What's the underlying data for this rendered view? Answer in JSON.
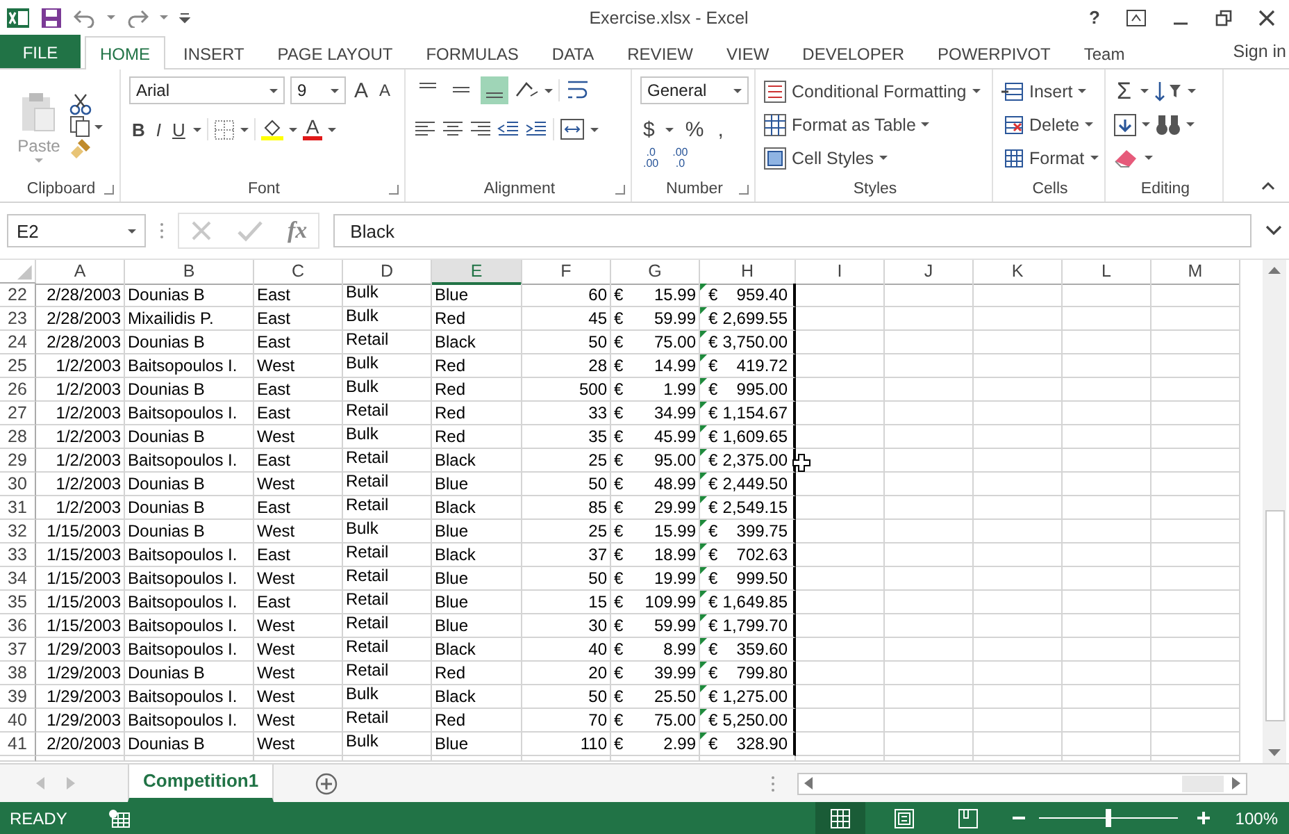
{
  "title_bar": {
    "title": "Exercise.xlsx - Excel",
    "help": "?"
  },
  "tabs": [
    {
      "label": "FILE",
      "kind": "file",
      "selected": false
    },
    {
      "label": "HOME",
      "kind": "tab",
      "selected": true
    },
    {
      "label": "INSERT",
      "kind": "tab",
      "selected": false
    },
    {
      "label": "PAGE LAYOUT",
      "kind": "tab",
      "selected": false
    },
    {
      "label": "FORMULAS",
      "kind": "tab",
      "selected": false
    },
    {
      "label": "DATA",
      "kind": "tab",
      "selected": false
    },
    {
      "label": "REVIEW",
      "kind": "tab",
      "selected": false
    },
    {
      "label": "VIEW",
      "kind": "tab",
      "selected": false
    },
    {
      "label": "DEVELOPER",
      "kind": "tab",
      "selected": false
    },
    {
      "label": "POWERPIVOT",
      "kind": "tab",
      "selected": false
    },
    {
      "label": "Team",
      "kind": "tab",
      "selected": false
    }
  ],
  "sign_in": "Sign in",
  "ribbon": {
    "clipboard": {
      "label": "Clipboard",
      "paste": "Paste"
    },
    "font": {
      "label": "Font",
      "name": "Arial",
      "size": "9",
      "grow": "A",
      "shrink": "A",
      "styles": [
        "B",
        "I",
        "U"
      ],
      "color_letter": "A"
    },
    "alignment": {
      "label": "Alignment",
      "vertical": [
        {
          "kind": "top",
          "selected": false
        },
        {
          "kind": "middle",
          "selected": false
        },
        {
          "kind": "bottom",
          "selected": true
        }
      ]
    },
    "number": {
      "label": "Number",
      "format": "General",
      "currency": "$",
      "percent": "%",
      "comma": ",",
      "increase_decimal": [
        ".0",
        ".00"
      ],
      "decrease_decimal": [
        ".00",
        ".0"
      ]
    },
    "styles": {
      "label": "Styles",
      "items": [
        {
          "kind": "conditional",
          "label": "Conditional Formatting"
        },
        {
          "kind": "table",
          "label": "Format as Table"
        },
        {
          "kind": "cell",
          "label": "Cell Styles"
        }
      ]
    },
    "cells": {
      "label": "Cells",
      "items": [
        {
          "kind": "insert",
          "label": "Insert"
        },
        {
          "kind": "delete",
          "label": "Delete"
        },
        {
          "kind": "format",
          "label": "Format"
        }
      ]
    },
    "editing": {
      "label": "Editing",
      "sum": "Σ"
    }
  },
  "formula_bar": {
    "name_box": "E2",
    "fx": "fx",
    "value": "Black"
  },
  "sheet": {
    "columns": [
      {
        "label": "A",
        "selected": false
      },
      {
        "label": "B",
        "selected": false
      },
      {
        "label": "C",
        "selected": false
      },
      {
        "label": "D",
        "selected": false
      },
      {
        "label": "E",
        "selected": true
      },
      {
        "label": "F",
        "selected": false
      },
      {
        "label": "G",
        "selected": false
      },
      {
        "label": "H",
        "selected": false
      },
      {
        "label": "I",
        "selected": false
      },
      {
        "label": "J",
        "selected": false
      },
      {
        "label": "K",
        "selected": false
      },
      {
        "label": "L",
        "selected": false
      },
      {
        "label": "M",
        "selected": false
      }
    ],
    "rows": [
      {
        "n": "22",
        "a": "2/28/2003",
        "b": "Dounias B",
        "c": "East",
        "d": "Bulk",
        "e": "Blue",
        "f": "60",
        "g": [
          "€",
          "15.99"
        ],
        "h": [
          "€",
          "959.40"
        ],
        "flag": true
      },
      {
        "n": "23",
        "a": "2/28/2003",
        "b": "Mixailidis P.",
        "c": "East",
        "d": "Bulk",
        "e": "Red",
        "f": "45",
        "g": [
          "€",
          "59.99"
        ],
        "h": [
          "€",
          "2,699.55"
        ],
        "flag": true
      },
      {
        "n": "24",
        "a": "2/28/2003",
        "b": "Dounias B",
        "c": "East",
        "d": "Retail",
        "e": "Black",
        "f": "50",
        "g": [
          "€",
          "75.00"
        ],
        "h": [
          "€",
          "3,750.00"
        ],
        "flag": true
      },
      {
        "n": "25",
        "a": "1/2/2003",
        "b": "Baitsopoulos I.",
        "c": "West",
        "d": "Bulk",
        "e": "Red",
        "f": "28",
        "g": [
          "€",
          "14.99"
        ],
        "h": [
          "€",
          "419.72"
        ],
        "flag": true
      },
      {
        "n": "26",
        "a": "1/2/2003",
        "b": "Dounias B",
        "c": "East",
        "d": "Bulk",
        "e": "Red",
        "f": "500",
        "g": [
          "€",
          "1.99"
        ],
        "h": [
          "€",
          "995.00"
        ],
        "flag": true
      },
      {
        "n": "27",
        "a": "1/2/2003",
        "b": "Baitsopoulos I.",
        "c": "East",
        "d": "Retail",
        "e": "Red",
        "f": "33",
        "g": [
          "€",
          "34.99"
        ],
        "h": [
          "€",
          "1,154.67"
        ],
        "flag": true
      },
      {
        "n": "28",
        "a": "1/2/2003",
        "b": "Dounias B",
        "c": "West",
        "d": "Bulk",
        "e": "Red",
        "f": "35",
        "g": [
          "€",
          "45.99"
        ],
        "h": [
          "€",
          "1,609.65"
        ],
        "flag": true
      },
      {
        "n": "29",
        "a": "1/2/2003",
        "b": "Baitsopoulos I.",
        "c": "East",
        "d": "Retail",
        "e": "Black",
        "f": "25",
        "g": [
          "€",
          "95.00"
        ],
        "h": [
          "€",
          "2,375.00"
        ],
        "flag": true
      },
      {
        "n": "30",
        "a": "1/2/2003",
        "b": "Dounias B",
        "c": "West",
        "d": "Retail",
        "e": "Blue",
        "f": "50",
        "g": [
          "€",
          "48.99"
        ],
        "h": [
          "€",
          "2,449.50"
        ],
        "flag": true
      },
      {
        "n": "31",
        "a": "1/2/2003",
        "b": "Dounias B",
        "c": "East",
        "d": "Retail",
        "e": "Black",
        "f": "85",
        "g": [
          "€",
          "29.99"
        ],
        "h": [
          "€",
          "2,549.15"
        ],
        "flag": true
      },
      {
        "n": "32",
        "a": "1/15/2003",
        "b": "Dounias B",
        "c": "West",
        "d": "Bulk",
        "e": "Blue",
        "f": "25",
        "g": [
          "€",
          "15.99"
        ],
        "h": [
          "€",
          "399.75"
        ],
        "flag": true
      },
      {
        "n": "33",
        "a": "1/15/2003",
        "b": "Baitsopoulos I.",
        "c": "East",
        "d": "Retail",
        "e": "Black",
        "f": "37",
        "g": [
          "€",
          "18.99"
        ],
        "h": [
          "€",
          "702.63"
        ],
        "flag": true
      },
      {
        "n": "34",
        "a": "1/15/2003",
        "b": "Baitsopoulos I.",
        "c": "West",
        "d": "Retail",
        "e": "Blue",
        "f": "50",
        "g": [
          "€",
          "19.99"
        ],
        "h": [
          "€",
          "999.50"
        ],
        "flag": true
      },
      {
        "n": "35",
        "a": "1/15/2003",
        "b": "Baitsopoulos I.",
        "c": "East",
        "d": "Retail",
        "e": "Blue",
        "f": "15",
        "g": [
          "€",
          "109.99"
        ],
        "h": [
          "€",
          "1,649.85"
        ],
        "flag": true
      },
      {
        "n": "36",
        "a": "1/15/2003",
        "b": "Baitsopoulos I.",
        "c": "West",
        "d": "Retail",
        "e": "Blue",
        "f": "30",
        "g": [
          "€",
          "59.99"
        ],
        "h": [
          "€",
          "1,799.70"
        ],
        "flag": true
      },
      {
        "n": "37",
        "a": "1/29/2003",
        "b": "Baitsopoulos I.",
        "c": "West",
        "d": "Retail",
        "e": "Black",
        "f": "40",
        "g": [
          "€",
          "8.99"
        ],
        "h": [
          "€",
          "359.60"
        ],
        "flag": true
      },
      {
        "n": "38",
        "a": "1/29/2003",
        "b": "Dounias B",
        "c": "West",
        "d": "Retail",
        "e": "Red",
        "f": "20",
        "g": [
          "€",
          "39.99"
        ],
        "h": [
          "€",
          "799.80"
        ],
        "flag": true
      },
      {
        "n": "39",
        "a": "1/29/2003",
        "b": "Baitsopoulos I.",
        "c": "West",
        "d": "Bulk",
        "e": "Black",
        "f": "50",
        "g": [
          "€",
          "25.50"
        ],
        "h": [
          "€",
          "1,275.00"
        ],
        "flag": true
      },
      {
        "n": "40",
        "a": "1/29/2003",
        "b": "Baitsopoulos I.",
        "c": "West",
        "d": "Retail",
        "e": "Red",
        "f": "70",
        "g": [
          "€",
          "75.00"
        ],
        "h": [
          "€",
          "5,250.00"
        ],
        "flag": true
      },
      {
        "n": "41",
        "a": "2/20/2003",
        "b": "Dounias B",
        "c": "West",
        "d": "Bulk",
        "e": "Blue",
        "f": "110",
        "g": [
          "€",
          "2.99"
        ],
        "h": [
          "€",
          "328.90"
        ],
        "flag": true
      }
    ]
  },
  "sheet_tabs": [
    {
      "label": "Competition1",
      "selected": true
    }
  ],
  "status_bar": {
    "mode": "READY",
    "views": [
      {
        "kind": "normal",
        "selected": true
      },
      {
        "kind": "page_layout",
        "selected": false
      },
      {
        "kind": "page_break",
        "selected": false
      }
    ],
    "zoom": {
      "level": 0.5,
      "reading": "100%"
    }
  }
}
